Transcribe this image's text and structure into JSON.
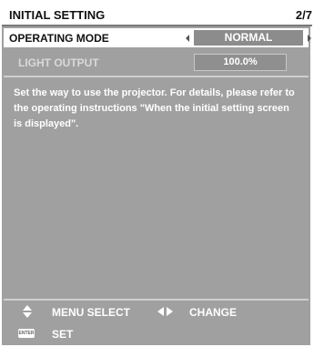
{
  "header": {
    "title": "INITIAL SETTING",
    "page": "2/7"
  },
  "settings": [
    {
      "label": "OPERATING MODE",
      "value": "NORMAL"
    },
    {
      "label": "LIGHT OUTPUT",
      "value": "100.0%"
    }
  ],
  "description": "Set the way to use the projector. For details, please refer to the operating instructions \"When the initial setting screen is displayed\".",
  "footer": {
    "menu_select": "MENU SELECT",
    "change": "CHANGE",
    "set": "SET",
    "enter_icon_text": "ENTER"
  },
  "colors": {
    "panel": "#a0a0a0",
    "value_box": "#8c8c8c",
    "text_light": "#ffffff"
  }
}
